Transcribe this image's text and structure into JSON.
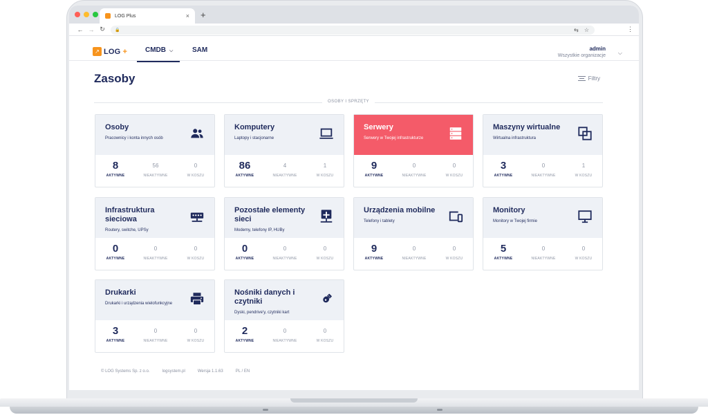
{
  "browser": {
    "tab_title": "LOG Plus",
    "tab_close": "×",
    "new_tab": "+",
    "nav_back": "←",
    "nav_forward": "→",
    "nav_reload": "↻",
    "lock": "🔒",
    "translate": "⇆",
    "star": "☆",
    "menu": "⋮"
  },
  "header": {
    "logo_text": "LOG",
    "logo_plus": "+",
    "tabs": [
      {
        "label": "CMDB",
        "chevron": "⌵"
      },
      {
        "label": "SAM"
      }
    ],
    "user": {
      "name": "admin",
      "org": "Wszystkie organizacje",
      "chevron": "⌵"
    }
  },
  "page": {
    "title": "Zasoby",
    "filters_label": "Filtry",
    "section_label": "OSOBY I SPRZĘTY"
  },
  "stat_labels": {
    "active": "AKTYWNE",
    "inactive": "NIEAKTYWNE",
    "trash": "W KOSZU"
  },
  "cards": [
    {
      "title": "Osoby",
      "subtitle": "Pracownicy i konta innych osób",
      "icon": "people-icon",
      "active": "8",
      "inactive": "56",
      "trash": "0"
    },
    {
      "title": "Komputery",
      "subtitle": "Laptopy i stacjonarne",
      "icon": "laptop-icon",
      "active": "86",
      "inactive": "4",
      "trash": "1"
    },
    {
      "title": "Serwery",
      "subtitle": "Serwery w Twojej infrastrukturze",
      "icon": "server-icon",
      "active": "9",
      "inactive": "0",
      "trash": "0"
    },
    {
      "title": "Maszyny wirtualne",
      "subtitle": "Wirtualna infrastruktura",
      "icon": "virtual-machine-icon",
      "active": "3",
      "inactive": "0",
      "trash": "1"
    },
    {
      "title": "Infrastruktura sieciowa",
      "subtitle": "Routery, switche, UPSy",
      "icon": "network-switch-icon",
      "active": "0",
      "inactive": "0",
      "trash": "0"
    },
    {
      "title": "Pozostałe elementy sieci",
      "subtitle": "Modemy, telefony IP, HUBy",
      "icon": "network-node-icon",
      "active": "0",
      "inactive": "0",
      "trash": "0"
    },
    {
      "title": "Urządzenia mobilne",
      "subtitle": "Telefony i tablety",
      "icon": "mobile-devices-icon",
      "active": "9",
      "inactive": "0",
      "trash": "0"
    },
    {
      "title": "Monitory",
      "subtitle": "Monitory w Twojej firmie",
      "icon": "monitor-icon",
      "active": "5",
      "inactive": "0",
      "trash": "0"
    },
    {
      "title": "Drukarki",
      "subtitle": "Drukarki i urządzenia wielofunkcyjne",
      "icon": "printer-icon",
      "active": "3",
      "inactive": "0",
      "trash": "0"
    },
    {
      "title": "Nośniki danych i czytniki",
      "subtitle": "Dyski, pendrive'y, czytniki kart",
      "icon": "usb-drive-icon",
      "active": "2",
      "inactive": "0",
      "trash": "0"
    }
  ],
  "footer": {
    "company": "© LOG Systems Sp. z o.o.",
    "site": "logsystem.pl",
    "version": "Wersja 1.1.63",
    "lang": "PL / EN"
  },
  "colors": {
    "accent": "#f45b69",
    "brand": "#1f2a5c",
    "logo": "#f7941d"
  }
}
